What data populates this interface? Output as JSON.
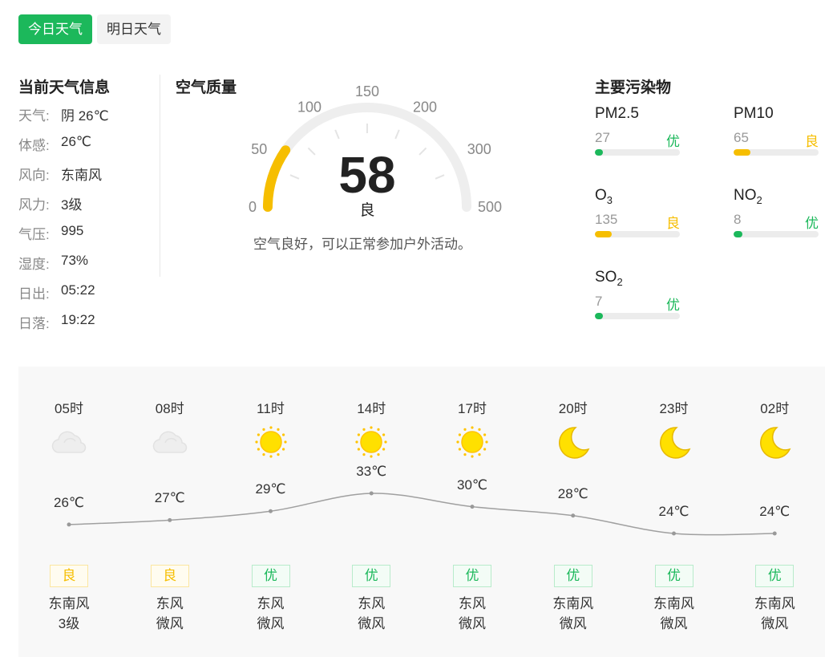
{
  "tabs": [
    {
      "label": "今日天气",
      "active": true
    },
    {
      "label": "明日天气",
      "active": false
    }
  ],
  "current": {
    "title": "当前天气信息",
    "rows": [
      {
        "key": "天气:",
        "value": "阴 26℃"
      },
      {
        "key": "体感:",
        "value": "26℃"
      },
      {
        "key": "风向:",
        "value": "东南风"
      },
      {
        "key": "风力:",
        "value": "3级"
      },
      {
        "key": "气压:",
        "value": "995"
      },
      {
        "key": "湿度:",
        "value": "73%"
      },
      {
        "key": "日出:",
        "value": "05:22"
      },
      {
        "key": "日落:",
        "value": "19:22"
      }
    ]
  },
  "aqi": {
    "title": "空气质量",
    "value": "58",
    "value_num": 58,
    "level": "良",
    "description": "空气良好，可以正常参加户外活动。",
    "scale_labels": [
      "0",
      "50",
      "100",
      "150",
      "200",
      "300",
      "500"
    ],
    "fill_color": "#f6be00",
    "track_color": "#eeeeee"
  },
  "pollutants": {
    "title": "主要污染物",
    "items": [
      {
        "name": "PM2.5",
        "sub": "",
        "value": "27",
        "level": "优",
        "fraction": 0.09,
        "color": "#1cb85b"
      },
      {
        "name": "PM10",
        "sub": "",
        "value": "65",
        "level": "良",
        "fraction": 0.2,
        "color": "#f6be00"
      },
      {
        "name": "O",
        "sub": "3",
        "value": "135",
        "level": "良",
        "fraction": 0.2,
        "color": "#f6be00"
      },
      {
        "name": "NO",
        "sub": "2",
        "value": "8",
        "level": "优",
        "fraction": 0.1,
        "color": "#1cb85b"
      },
      {
        "name": "SO",
        "sub": "2",
        "value": "7",
        "level": "优",
        "fraction": 0.09,
        "color": "#1cb85b"
      }
    ]
  },
  "hourly": [
    {
      "time": "05时",
      "icon": "cloud-icon",
      "temp": "26℃",
      "temp_value": 26,
      "aq": "良",
      "wind_dir": "东南风",
      "wind_power": "3级"
    },
    {
      "time": "08时",
      "icon": "cloud-icon",
      "temp": "27℃",
      "temp_value": 27,
      "aq": "良",
      "wind_dir": "东风",
      "wind_power": "微风"
    },
    {
      "time": "11时",
      "icon": "sun-icon",
      "temp": "29℃",
      "temp_value": 29,
      "aq": "优",
      "wind_dir": "东风",
      "wind_power": "微风"
    },
    {
      "time": "14时",
      "icon": "sun-icon",
      "temp": "33℃",
      "temp_value": 33,
      "aq": "优",
      "wind_dir": "东风",
      "wind_power": "微风"
    },
    {
      "time": "17时",
      "icon": "sun-icon",
      "temp": "30℃",
      "temp_value": 30,
      "aq": "优",
      "wind_dir": "东风",
      "wind_power": "微风"
    },
    {
      "time": "20时",
      "icon": "moon-icon",
      "temp": "28℃",
      "temp_value": 28,
      "aq": "优",
      "wind_dir": "东南风",
      "wind_power": "微风"
    },
    {
      "time": "23时",
      "icon": "moon-icon",
      "temp": "24℃",
      "temp_value": 24,
      "aq": "优",
      "wind_dir": "东南风",
      "wind_power": "微风"
    },
    {
      "time": "02时",
      "icon": "moon-icon",
      "temp": "24℃",
      "temp_value": 24,
      "aq": "优",
      "wind_dir": "东南风",
      "wind_power": "微风"
    }
  ],
  "colors": {
    "accent": "#1cb85b",
    "good": "#f6be00",
    "excellent": "#1cb85b",
    "sun": "#ffe000",
    "moon": "#ffe000",
    "cloud": "#eeeeee"
  }
}
